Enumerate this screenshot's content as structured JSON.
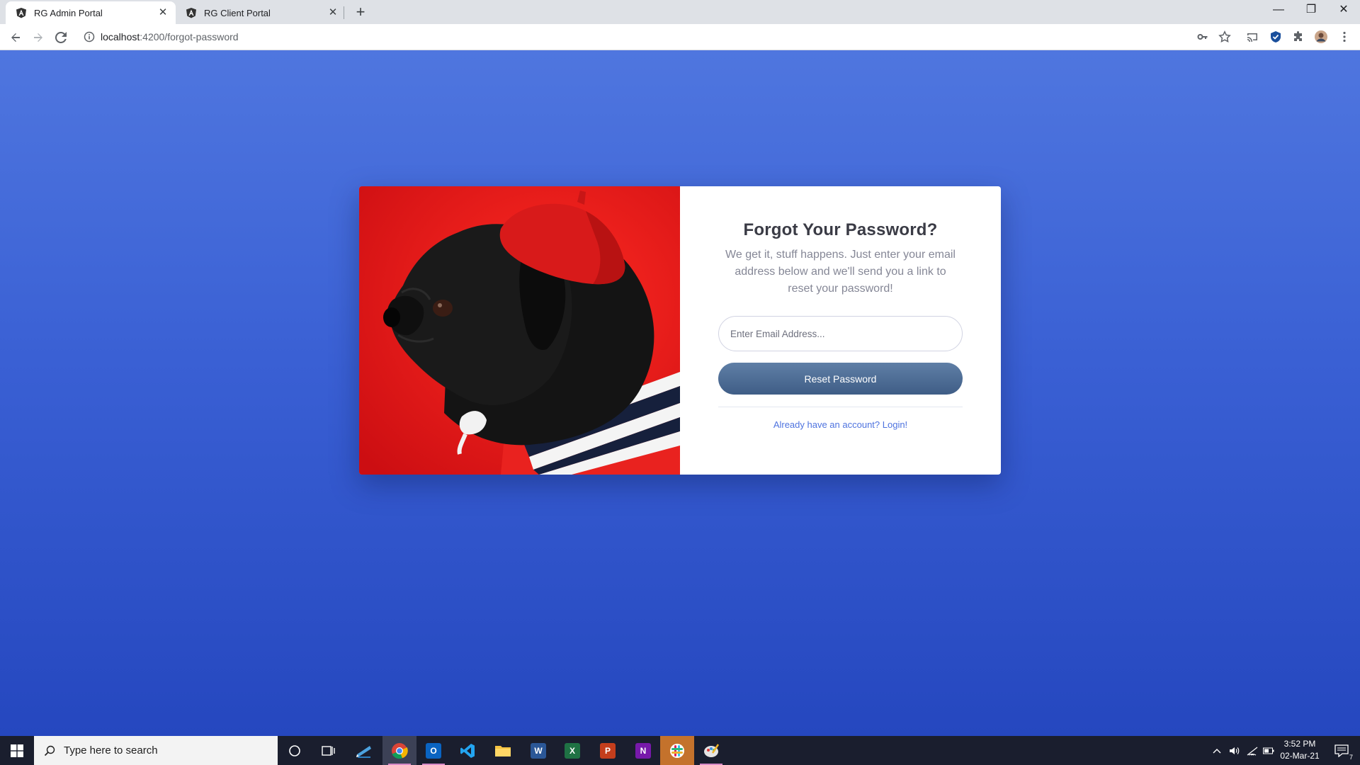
{
  "browser": {
    "tabs": [
      {
        "label": "RG Admin Portal",
        "active": true
      },
      {
        "label": "RG Client Portal",
        "active": false
      }
    ],
    "url_host": "localhost",
    "url_path": ":4200/forgot-password"
  },
  "form": {
    "title": "Forgot Your Password?",
    "description": "We get it, stuff happens. Just enter your email address below and we'll send you a link to reset your password!",
    "email_placeholder": "Enter Email Address...",
    "reset_label": "Reset Password",
    "login_link": "Already have an account? Login!"
  },
  "taskbar": {
    "search_placeholder": "Type here to search",
    "time": "3:52 PM",
    "date": "02-Mar-21",
    "notification_count": "7"
  },
  "colors": {
    "page_background": "#3a60d4",
    "image_background": "#e8141a",
    "button": "#4a6890",
    "link": "#4e73df"
  }
}
